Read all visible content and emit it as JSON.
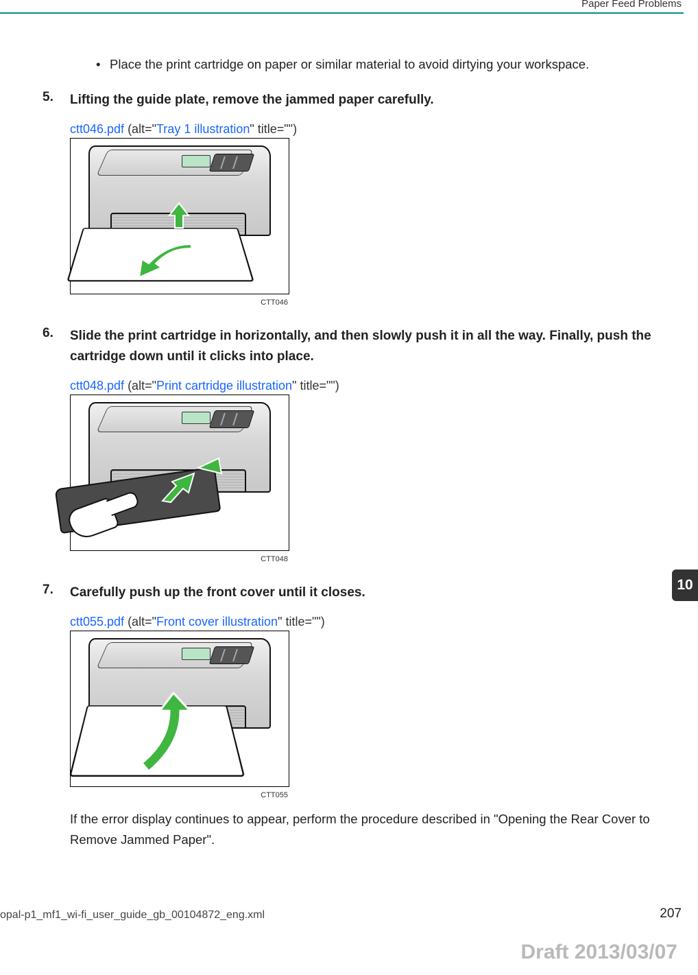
{
  "header": {
    "title": "Paper Feed Problems"
  },
  "chapter": {
    "number": "10"
  },
  "bullet": {
    "text": "Place the print cartridge on paper or similar material to avoid dirtying your workspace."
  },
  "steps": [
    {
      "num": "5.",
      "title": "Lifting the guide plate, remove the jammed paper carefully.",
      "fig": {
        "file": "ctt046.pdf",
        "pre": " (alt=\"",
        "alt": "Tray 1 illustration",
        "post": "\" title=\"\")",
        "code": "CTT046"
      }
    },
    {
      "num": "6.",
      "title": "Slide the print cartridge in horizontally, and then slowly push it in all the way. Finally, push the cartridge down until it clicks into place.",
      "fig": {
        "file": "ctt048.pdf",
        "pre": " (alt=\"",
        "alt": "Print cartridge illustration",
        "post": "\" title=\"\")",
        "code": "CTT048"
      }
    },
    {
      "num": "7.",
      "title": "Carefully push up the front cover until it closes.",
      "fig": {
        "file": "ctt055.pdf",
        "pre": " (alt=\"",
        "alt": "Front cover illustration",
        "post": "\" title=\"\")",
        "code": "CTT055"
      },
      "note": "If the error display continues to appear, perform the procedure described in \"Opening the Rear Cover to Remove Jammed Paper\"."
    }
  ],
  "footer": {
    "xml": "opal-p1_mf1_wi-fi_user_guide_gb_00104872_eng.xml",
    "page": "207"
  },
  "draft": "Draft 2013/03/07"
}
